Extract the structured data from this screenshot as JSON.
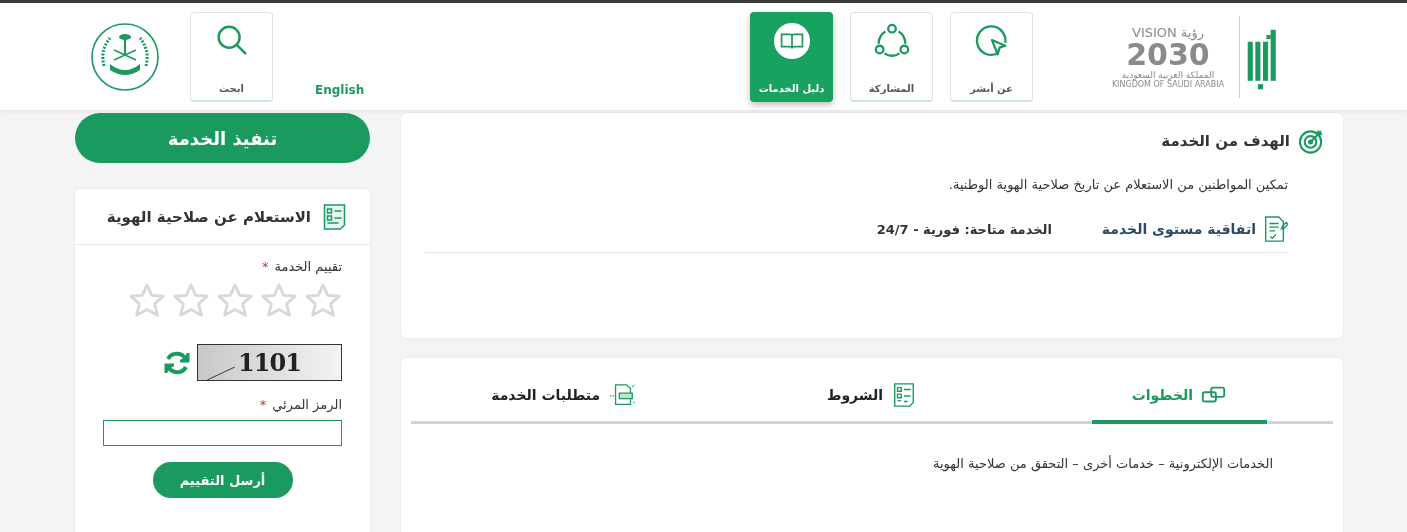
{
  "header": {
    "logo": {
      "vision_en": "VISION",
      "vision_ar": "رؤية",
      "year": "2030",
      "country_ar": "المملكة العربية السعودية",
      "country_en": "KINGDOM OF SAUDI ARABIA"
    },
    "nav": [
      {
        "label": "عن أبشر",
        "kind": "cursor",
        "selected": false
      },
      {
        "label": "المشاركة",
        "kind": "share",
        "selected": false
      },
      {
        "label": "دليل الخدمات",
        "kind": "book",
        "selected": true
      }
    ],
    "language_link": "English",
    "search": {
      "label": "ابحث"
    }
  },
  "execute_button": "تنفيذ الخدمة",
  "side_card": {
    "title": "الاستعلام عن صلاحية الهوية",
    "rating_label": "تقييم الخدمة",
    "rating_required": "*",
    "stars": 0,
    "captcha_text": "1101",
    "code_label": "الرمز المرئي",
    "code_required": "*",
    "submit": "أرسل التقييم"
  },
  "goal_card": {
    "title": "الهدف من الخدمة",
    "text": "تمكين المواطنين من الاستعلام عن تاريخ صلاحية الهوية الوطنية.",
    "sla_link": "اتفاقية مستوى الخدمة",
    "availability": "الخدمة متاحة: فورية - 24/7"
  },
  "tabs": [
    {
      "label": "الخطوات",
      "kind": "steps",
      "selected": true
    },
    {
      "label": "الشروط",
      "kind": "checklist",
      "selected": false
    },
    {
      "label": "متطلبات الخدمة",
      "kind": "docs",
      "selected": false
    }
  ],
  "steps_text": "الخدمات الإلكترونية – خدمات أخرى – التحقق من صلاحية الهوية"
}
